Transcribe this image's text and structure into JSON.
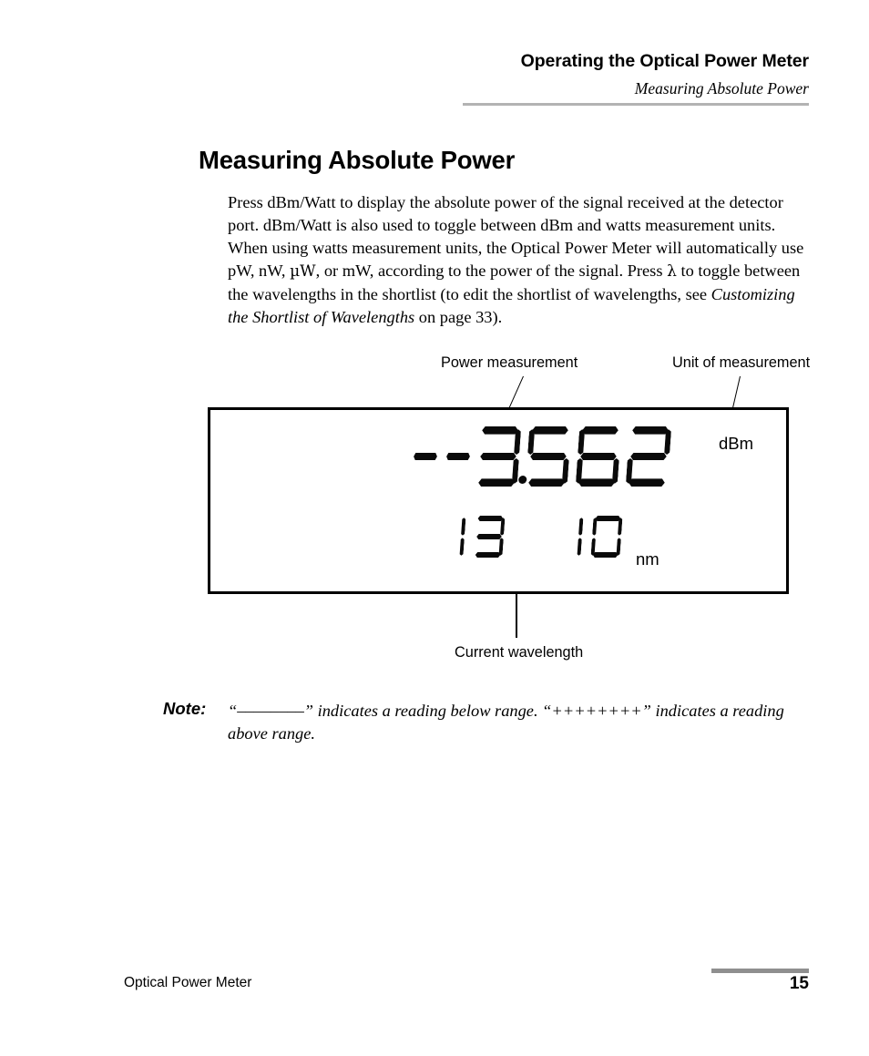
{
  "header": {
    "title": "Operating the Optical Power Meter",
    "subtitle": "Measuring Absolute Power",
    "rule_color": "#b3b3b3"
  },
  "section": {
    "heading": "Measuring Absolute Power",
    "paragraph_part1": "Press dBm/Watt to display the absolute power of the signal received at the detector port. dBm/Watt is also used to toggle between dBm and watts measurement units. When using watts measurement units, the Optical Power Meter will automatically use pW, nW, ",
    "paragraph_mu": "µW",
    "paragraph_part2": ", or mW, according to the power of the signal. Press ",
    "paragraph_lambda": "λ",
    "paragraph_part3": " to toggle between the wavelengths in the shortlist (to edit the shortlist of wavelengths, see ",
    "paragraph_italic_ref": "Customizing the Shortlist of Wavelengths",
    "paragraph_part4": " on page 33)."
  },
  "figure": {
    "callouts": {
      "power_measurement": "Power measurement",
      "unit_of_measurement": "Unit of measurement",
      "current_wavelength": "Current wavelength"
    },
    "lcd": {
      "power_reading": "-3.562",
      "power_unit": "dBm",
      "wavelength_reading": "1310",
      "wavelength_unit": "nm",
      "power_digits": [
        "blank",
        "minus",
        "3.",
        "5",
        "6",
        "2"
      ],
      "wavelength_digits": [
        "1",
        "3",
        "blank",
        "1",
        "0"
      ]
    }
  },
  "note": {
    "label": "Note:",
    "text_part1": "“––––––––” indicates a reading below range. “++++++++” indicates a reading above range.",
    "below_range_symbol": "––––––––",
    "above_range_symbol": "++++++++"
  },
  "footer": {
    "document_title": "Optical Power Meter",
    "page_number": "15",
    "rule_color": "#8f8f8f"
  }
}
